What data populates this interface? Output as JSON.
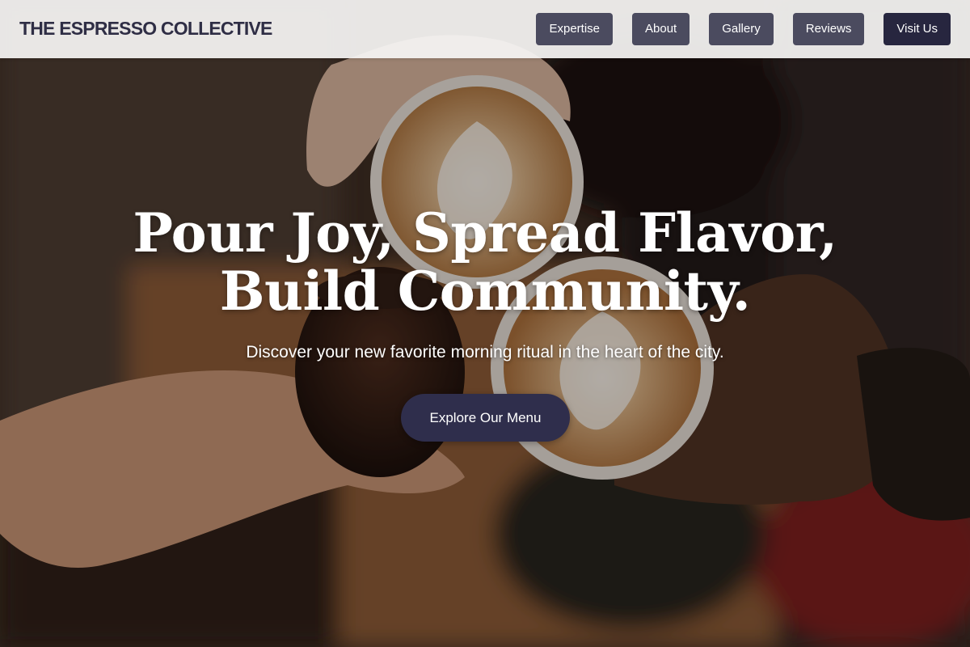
{
  "brand": {
    "name": "THE ESPRESSO COLLECTIVE"
  },
  "nav": {
    "items": [
      {
        "label": "Expertise"
      },
      {
        "label": "About"
      },
      {
        "label": "Gallery"
      },
      {
        "label": "Reviews"
      },
      {
        "label": "Visit Us"
      }
    ]
  },
  "hero": {
    "title_line1": "Pour Joy, Spread Flavor,",
    "title_line2": "Build Community.",
    "subtitle": "Discover your new favorite morning ritual in the heart of the city.",
    "cta_label": "Explore Our Menu"
  },
  "colors": {
    "brand_text": "#2f2e45",
    "nav_button": "#4b4b5f",
    "nav_cta": "#27263f",
    "hero_cta": "#2f2e4c"
  }
}
